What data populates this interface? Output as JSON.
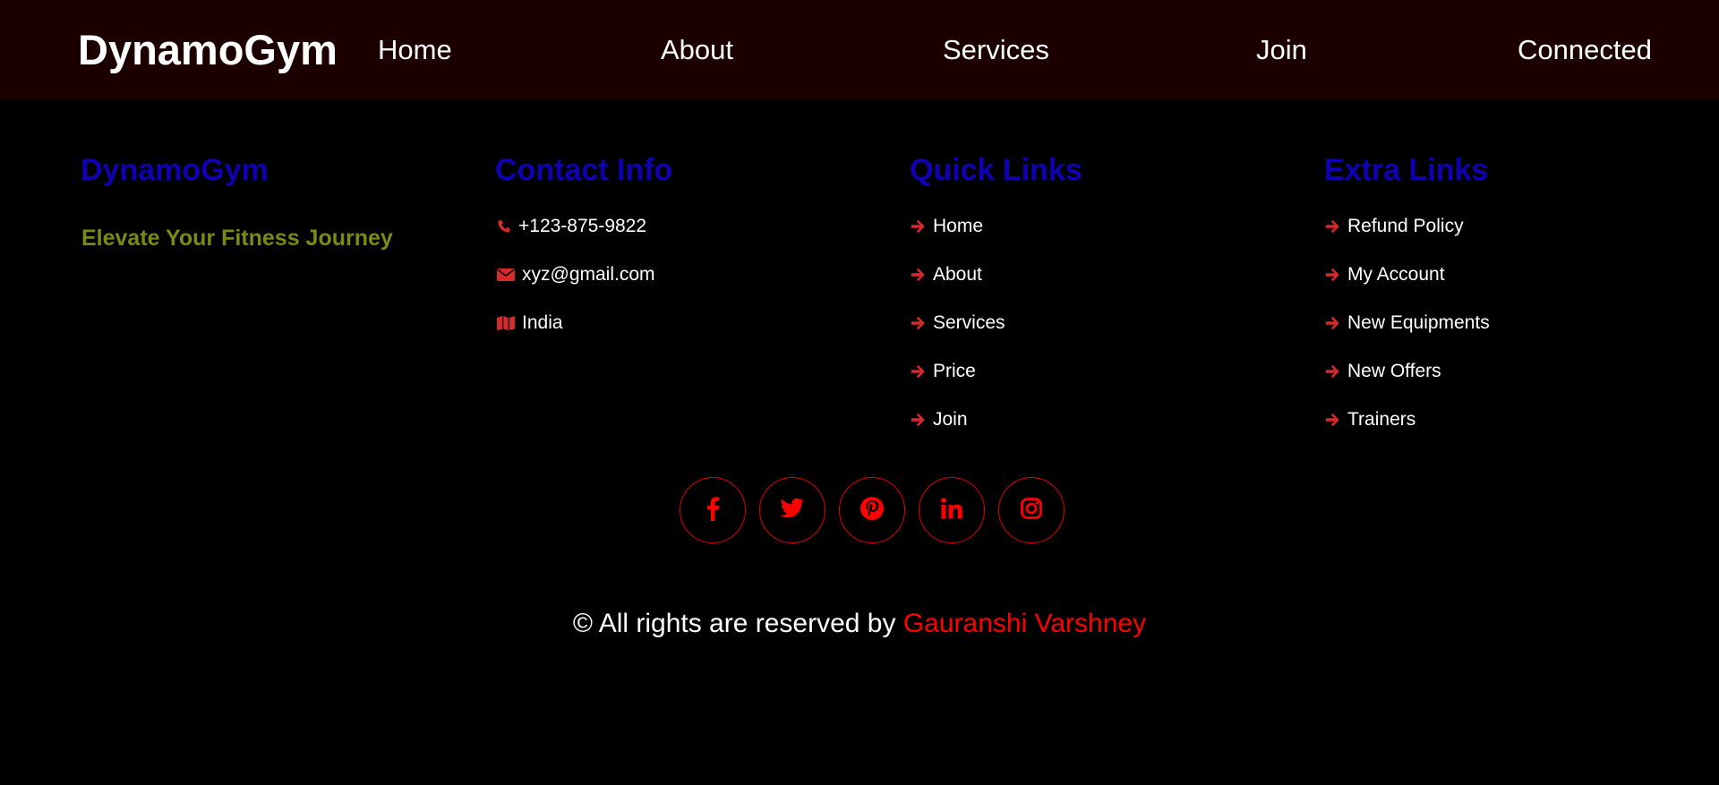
{
  "navbar": {
    "logo": "DynamoGym",
    "links": [
      "Home",
      "About",
      "Services",
      "Join",
      "Connected"
    ]
  },
  "footer": {
    "brand": {
      "title": "DynamoGym",
      "tagline": "Elevate Your Fitness Journey"
    },
    "contact": {
      "title": "Contact Info",
      "items": [
        {
          "icon": "phone-icon",
          "text": "+123-875-9822"
        },
        {
          "icon": "envelope-icon",
          "text": "xyz@gmail.com"
        },
        {
          "icon": "map-icon",
          "text": "India"
        }
      ]
    },
    "quick_links": {
      "title": "Quick Links",
      "items": [
        "Home",
        "About",
        "Services",
        "Price",
        "Join"
      ]
    },
    "extra_links": {
      "title": "Extra Links",
      "items": [
        "Refund Policy",
        "My Account",
        "New Equipments",
        "New Offers",
        "Trainers"
      ]
    },
    "social": [
      "facebook-icon",
      "twitter-icon",
      "pinterest-icon",
      "linkedin-icon",
      "instagram-icon"
    ],
    "copyright": {
      "prefix": "© All rights are reserved by ",
      "author": "Gauranshi Varshney"
    }
  },
  "colors": {
    "navbar_bg": "#1c0000",
    "heading": "#1000b4",
    "tagline": "#7a8a14",
    "icon": "#d62a2a",
    "accent": "#ff0000"
  }
}
